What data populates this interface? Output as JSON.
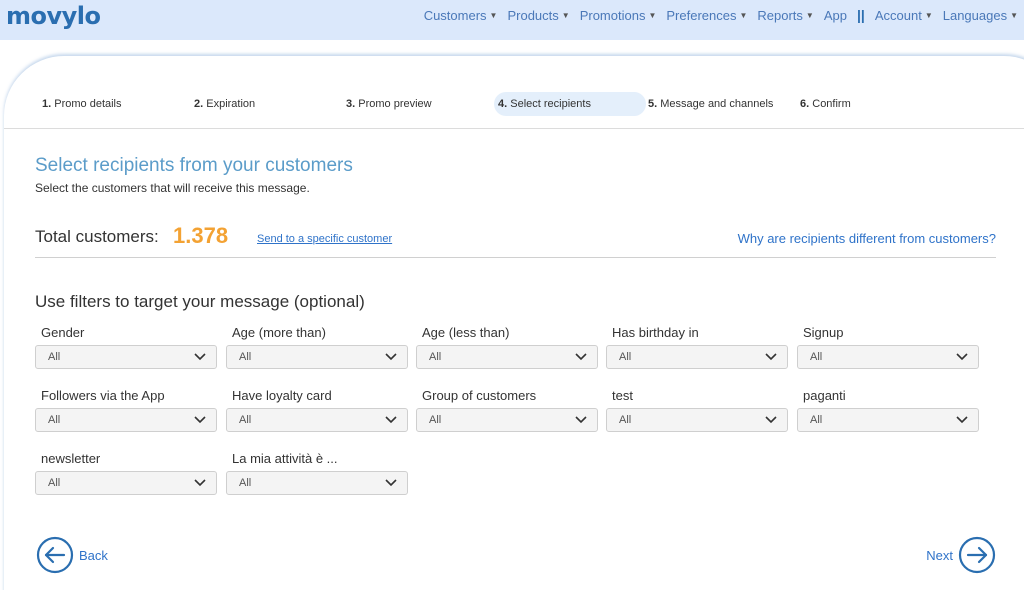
{
  "brand": {
    "logo_text": "movylo",
    "accent": "#2a6eb0",
    "highlight": "#f3a233"
  },
  "nav": {
    "items": [
      {
        "label": "Customers",
        "dropdown": true
      },
      {
        "label": "Products",
        "dropdown": true
      },
      {
        "label": "Promotions",
        "dropdown": true
      },
      {
        "label": "Preferences",
        "dropdown": true
      },
      {
        "label": "Reports",
        "dropdown": true
      },
      {
        "label": "App",
        "dropdown": false
      },
      {
        "label": "Account",
        "dropdown": true
      },
      {
        "label": "Languages",
        "dropdown": true
      }
    ],
    "separator": "||"
  },
  "steps": [
    {
      "num": "1.",
      "label": "Promo details",
      "active": false
    },
    {
      "num": "2.",
      "label": "Expiration",
      "active": false
    },
    {
      "num": "3.",
      "label": "Promo preview",
      "active": false
    },
    {
      "num": "4.",
      "label": "Select recipients",
      "active": true
    },
    {
      "num": "5.",
      "label": "Message and channels",
      "active": false
    },
    {
      "num": "6.",
      "label": "Confirm",
      "active": false
    }
  ],
  "main": {
    "title": "Select recipients from your customers",
    "subtitle": "Select the customers that will receive this message.",
    "total_label": "Total customers:",
    "total_value": "1.378",
    "send_link": "Send to a specific customer",
    "why_link": "Why are recipients different from customers?",
    "filters_title": "Use filters to target your message (optional)"
  },
  "filters": [
    {
      "label": "Gender",
      "value": "All"
    },
    {
      "label": "Age (more than)",
      "value": "All"
    },
    {
      "label": "Age (less than)",
      "value": "All"
    },
    {
      "label": "Has birthday in",
      "value": "All"
    },
    {
      "label": "Signup",
      "value": "All"
    },
    {
      "label": "Followers via the App",
      "value": "All"
    },
    {
      "label": "Have loyalty card",
      "value": "All"
    },
    {
      "label": "Group of customers",
      "value": "All"
    },
    {
      "label": "test",
      "value": "All"
    },
    {
      "label": "paganti",
      "value": "All"
    },
    {
      "label": "newsletter",
      "value": "All"
    },
    {
      "label": "La mia attività è ...",
      "value": "All"
    }
  ],
  "footer": {
    "back_label": "Back",
    "next_label": "Next"
  },
  "icons": {
    "back": "arrow-left-circle-icon",
    "next": "arrow-right-circle-icon",
    "dropdown": "chevron-down-icon"
  }
}
